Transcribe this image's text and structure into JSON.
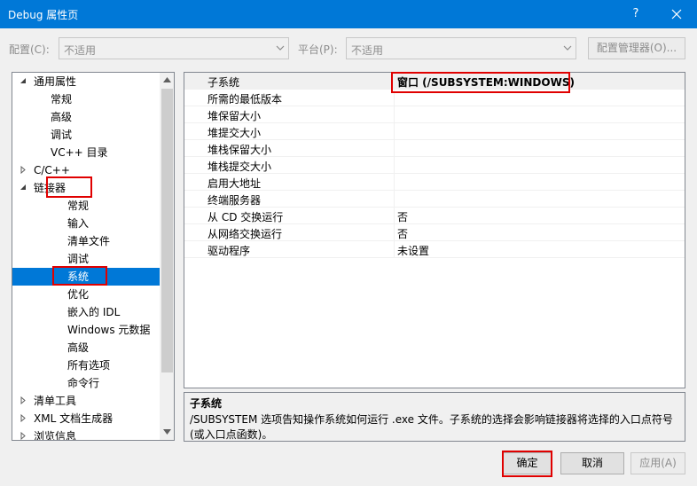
{
  "window": {
    "title": "Debug 属性页",
    "help": "?"
  },
  "config": {
    "config_label": "配置(C):",
    "config_value": "不适用",
    "platform_label": "平台(P):",
    "platform_value": "不适用",
    "manager_label": "配置管理器(O)..."
  },
  "tree": [
    {
      "label": "通用属性",
      "expander": "expanded"
    },
    {
      "label": "常规",
      "expander": ""
    },
    {
      "label": "高级",
      "expander": ""
    },
    {
      "label": "调试",
      "expander": ""
    },
    {
      "label": "VC++ 目录",
      "expander": ""
    },
    {
      "label": "C/C++",
      "expander": "collapsed"
    },
    {
      "label": "链接器",
      "expander": "expanded"
    },
    {
      "label": "常规",
      "expander": ""
    },
    {
      "label": "输入",
      "expander": ""
    },
    {
      "label": "清单文件",
      "expander": ""
    },
    {
      "label": "调试",
      "expander": ""
    },
    {
      "label": "系统",
      "expander": "",
      "selected": true
    },
    {
      "label": "优化",
      "expander": ""
    },
    {
      "label": "嵌入的 IDL",
      "expander": ""
    },
    {
      "label": "Windows 元数据",
      "expander": ""
    },
    {
      "label": "高级",
      "expander": ""
    },
    {
      "label": "所有选项",
      "expander": ""
    },
    {
      "label": "命令行",
      "expander": ""
    },
    {
      "label": "清单工具",
      "expander": "collapsed"
    },
    {
      "label": "XML 文档生成器",
      "expander": "collapsed"
    },
    {
      "label": "浏览信息",
      "expander": "collapsed"
    }
  ],
  "properties": [
    {
      "name": "子系统",
      "value": "窗口 (/SUBSYSTEM:WINDOWS)"
    },
    {
      "name": "所需的最低版本",
      "value": ""
    },
    {
      "name": "堆保留大小",
      "value": ""
    },
    {
      "name": "堆提交大小",
      "value": ""
    },
    {
      "name": "堆栈保留大小",
      "value": ""
    },
    {
      "name": "堆栈提交大小",
      "value": ""
    },
    {
      "name": "启用大地址",
      "value": ""
    },
    {
      "name": "终端服务器",
      "value": ""
    },
    {
      "name": "从 CD 交换运行",
      "value": "否"
    },
    {
      "name": "从网络交换运行",
      "value": "否"
    },
    {
      "name": "驱动程序",
      "value": "未设置"
    }
  ],
  "description": {
    "title": "子系统",
    "text": "/SUBSYSTEM 选项告知操作系统如何运行 .exe 文件。子系统的选择会影响链接器将选择的入口点符号(或入口点函数)。"
  },
  "buttons": {
    "ok": "确定",
    "cancel": "取消",
    "apply": "应用(A)"
  },
  "colors": {
    "accent": "#0078d7",
    "highlight": "#e00000"
  }
}
